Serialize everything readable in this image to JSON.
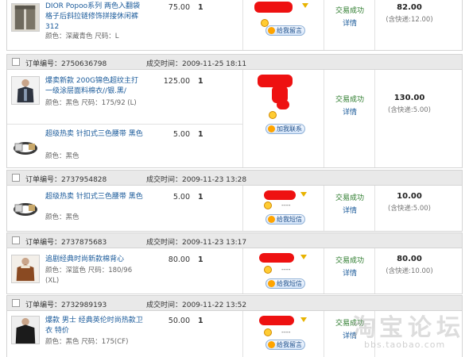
{
  "orders": [
    {
      "header": null,
      "items": [
        {
          "title": "DIOR Popoo系列 两色入翻袋格子后斜拉链修饰拼接休闲裤312",
          "attrs": "颜色：深藏青色  尺码：L",
          "price": "75.00",
          "qty": "1"
        }
      ],
      "seller": {
        "message_label": "给我留言"
      },
      "status": {
        "text": "交易成功",
        "detail": "详情"
      },
      "total": {
        "amount": "82.00",
        "shipping": "(含快递:12.00)"
      }
    },
    {
      "header": {
        "order_no": "订单编号：2750636798",
        "time": "成交时间：2009-11-25 18:11"
      },
      "items": [
        {
          "title": "爆卖新款 200G锦色超纹主打一级涂层面料棉衣//银.黑/",
          "attrs": "颜色：黑色  尺码：175/92 (L)",
          "price": "125.00",
          "qty": "1"
        },
        {
          "title": "超级热卖 针扣式三色腰带 黑色",
          "attrs": "颜色：黑色",
          "price": "5.00",
          "qty": "1"
        }
      ],
      "seller": {
        "message_label": "加我联系"
      },
      "status": {
        "text": "交易成功",
        "detail": "详情"
      },
      "total": {
        "amount": "130.00",
        "shipping": "(含快递:5.00)"
      }
    },
    {
      "header": {
        "order_no": "订单编号：2737954828",
        "time": "成交时间：2009-11-23 13:28"
      },
      "items": [
        {
          "title": "超级热卖 针扣式三色腰带 黑色",
          "attrs": "颜色：黑色",
          "price": "5.00",
          "qty": "1"
        }
      ],
      "seller": {
        "dash": "----",
        "message_label": "给我短信"
      },
      "status": {
        "text": "交易成功",
        "detail": "详情"
      },
      "total": {
        "amount": "10.00",
        "shipping": "(含快递:5.00)"
      }
    },
    {
      "header": {
        "order_no": "订单编号：2737875683",
        "time": "成交时间：2009-11-23 13:17"
      },
      "items": [
        {
          "title": "追剧经典时尚新款棉背心",
          "attrs": "颜色：深篮色  尺码：180/96 (XL)",
          "price": "80.00",
          "qty": "1"
        }
      ],
      "seller": {
        "dash": "----",
        "message_label": "给我短信"
      },
      "status": {
        "text": "交易成功",
        "detail": "详情"
      },
      "total": {
        "amount": "80.00",
        "shipping": "(含快递:10.00)"
      }
    },
    {
      "header": {
        "order_no": "订单编号：2732989193",
        "time": "成交时间：2009-11-22 13:52"
      },
      "items": [
        {
          "title": "爆款 男士 经典英伦时尚热款卫衣 特价",
          "attrs": "颜色：黑色  尺码：175(CF)",
          "price": "50.00",
          "qty": "1"
        }
      ],
      "seller": {
        "dash": "----",
        "message_label": "给我留言"
      },
      "status": {
        "text": "交易成功",
        "detail": "详情"
      },
      "total": {
        "amount": "",
        "shipping": ""
      }
    }
  ],
  "watermark": {
    "chars": [
      "淘",
      "宝",
      "论",
      "坛"
    ],
    "url": "bbs.taobao.com"
  },
  "colors": {
    "seller_mark": "#ee1111",
    "link": "#1a5a9a",
    "status": "#2a7a2a"
  }
}
